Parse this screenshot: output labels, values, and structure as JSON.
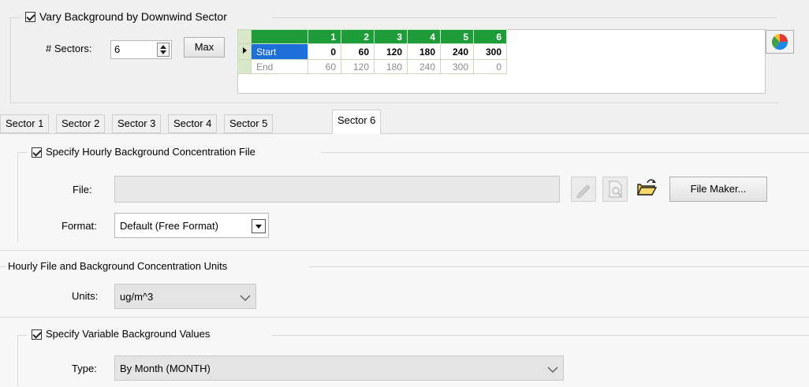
{
  "vary": {
    "label": "Vary Background by Downwind Sector",
    "checked": true
  },
  "sectors": {
    "label": "# Sectors:",
    "value": "6",
    "max_label": "Max"
  },
  "grid": {
    "columns": [
      "1",
      "2",
      "3",
      "4",
      "5",
      "6"
    ],
    "rows": [
      {
        "label": "Start",
        "values": [
          "0",
          "60",
          "120",
          "180",
          "240",
          "300"
        ]
      },
      {
        "label": "End",
        "values": [
          "60",
          "120",
          "180",
          "240",
          "300",
          "0"
        ]
      }
    ]
  },
  "tabs": [
    "Sector 1",
    "Sector 2",
    "Sector 3",
    "Sector 4",
    "Sector 5",
    "Sector 6"
  ],
  "active_tab": "Sector 6",
  "hourly": {
    "label": "Specify Hourly Background Concentration File",
    "file_label": "File:",
    "file_value": "",
    "format_label": "Format:",
    "format_value": "Default (Free Format)",
    "file_maker_label": "File Maker..."
  },
  "units_group": {
    "label": "Hourly File and Background Concentration Units",
    "units_label": "Units:",
    "units_value": "ug/m^3"
  },
  "variable": {
    "label": "Specify Variable Background Values",
    "type_label": "Type:",
    "type_value": "By Month (MONTH)"
  },
  "icons": [
    "pie-chart-icon",
    "edit-icon",
    "preview-icon",
    "open-folder-icon",
    "dropdown-arrow-icon",
    "chevron-down-icon",
    "spinner-icon",
    "row-pointer-icon"
  ]
}
